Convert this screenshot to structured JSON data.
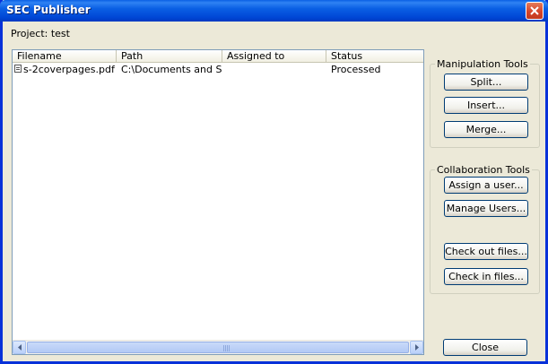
{
  "window": {
    "title": "SEC Publisher"
  },
  "project": {
    "label": "Project: test"
  },
  "file_list": {
    "columns": [
      "Filename",
      "Path",
      "Assigned to",
      "Status"
    ],
    "rows": [
      {
        "filename": "s-2coverpages.pdf",
        "path": "C:\\Documents and Settings\\...",
        "assigned_to": "",
        "status": "Processed"
      }
    ]
  },
  "manipulation_tools": {
    "title": "Manipulation Tools",
    "split_label": "Split...",
    "insert_label": "Insert...",
    "merge_label": "Merge..."
  },
  "collaboration_tools": {
    "title": "Collaboration Tools",
    "assign_label": "Assign a user...",
    "manage_label": "Manage Users...",
    "check_out_label": "Check out files...",
    "check_in_label": "Check in files..."
  },
  "footer": {
    "close_label": "Close"
  },
  "icons": {
    "close": "close-icon",
    "file": "document-icon",
    "scroll_left": "scroll-left-arrow-icon",
    "scroll_right": "scroll-right-arrow-icon"
  },
  "colors": {
    "title_bar": "#0a5fe4",
    "window_border": "#0831d9",
    "close_button": "#d5452b",
    "face": "#ece9d8"
  }
}
